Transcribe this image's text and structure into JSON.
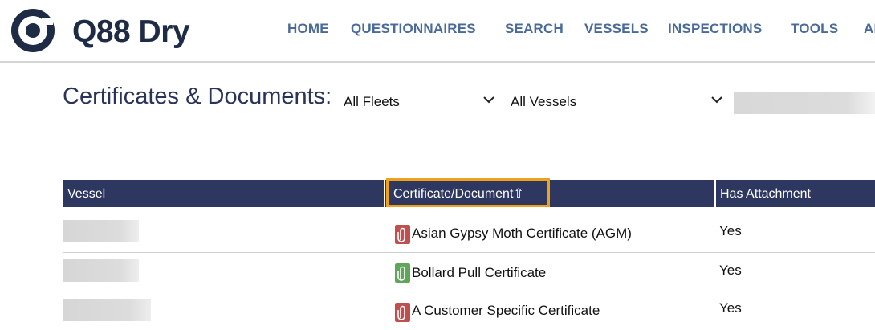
{
  "header": {
    "logo_text": "Q88 Dry",
    "nav": [
      {
        "label": "HOME"
      },
      {
        "label": "QUESTIONNAIRES"
      },
      {
        "label": "SEARCH"
      },
      {
        "label": "VESSELS"
      },
      {
        "label": "INSPECTIONS"
      },
      {
        "label": "TOOLS"
      },
      {
        "label": "AD"
      }
    ]
  },
  "page": {
    "title": "Certificates & Documents:",
    "filters": {
      "fleet": {
        "value": "All Fleets"
      },
      "vessel": {
        "value": "All Vessels"
      }
    }
  },
  "table": {
    "columns": {
      "vessel": "Vessel",
      "certificate": "Certificate/Document⇧",
      "attachment": "Has Attachment"
    },
    "rows": [
      {
        "vessel": "",
        "certificate": "Asian Gypsy Moth Certificate (AGM)",
        "icon": "paperclip-red-icon",
        "icon_color": "#c0504d",
        "has_attachment": "Yes"
      },
      {
        "vessel": "",
        "certificate": "Bollard Pull Certificate",
        "icon": "paperclip-green-icon",
        "icon_color": "#5fa55a",
        "has_attachment": "Yes"
      },
      {
        "vessel": "",
        "certificate": "A Customer Specific Certificate",
        "icon": "paperclip-red-icon",
        "icon_color": "#c0504d",
        "has_attachment": "Yes"
      }
    ]
  },
  "colors": {
    "brand": "#1d2b45",
    "nav": "#4a6a99",
    "table_header": "#2e3760",
    "sort_highlight": "#f0a11c"
  }
}
